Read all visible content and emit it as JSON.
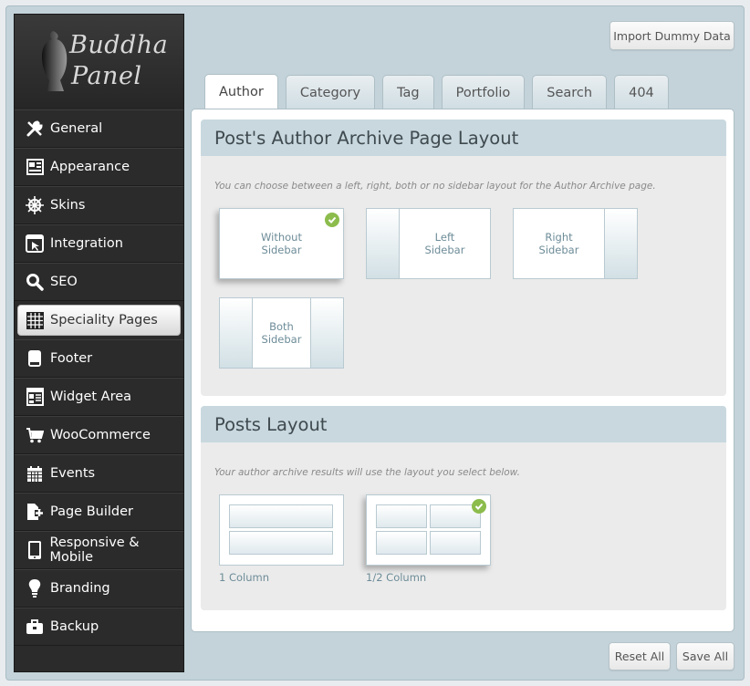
{
  "logo": {
    "line1": "Buddha",
    "line2": "Panel"
  },
  "sidebar": {
    "items": [
      {
        "label": "General",
        "icon": "wrench-screwdriver-icon"
      },
      {
        "label": "Appearance",
        "icon": "layout-icon"
      },
      {
        "label": "Skins",
        "icon": "ship-wheel-icon"
      },
      {
        "label": "Integration",
        "icon": "window-cursor-icon"
      },
      {
        "label": "SEO",
        "icon": "search-icon"
      },
      {
        "label": "Speciality Pages",
        "icon": "grid-icon",
        "active": true
      },
      {
        "label": "Footer",
        "icon": "footer-icon"
      },
      {
        "label": "Widget Area",
        "icon": "widget-icon"
      },
      {
        "label": "WooCommerce",
        "icon": "cart-icon"
      },
      {
        "label": "Events",
        "icon": "calendar-icon"
      },
      {
        "label": "Page Builder",
        "icon": "page-builder-icon"
      },
      {
        "label": "Responsive & Mobile",
        "icon": "mobile-icon"
      },
      {
        "label": "Branding",
        "icon": "lightbulb-icon"
      },
      {
        "label": "Backup",
        "icon": "briefcase-icon"
      }
    ]
  },
  "header": {
    "import_label": "Import Dummy Data"
  },
  "tabs": [
    "Author",
    "Category",
    "Tag",
    "Portfolio",
    "Search",
    "404"
  ],
  "active_tab": "Author",
  "section1": {
    "title": "Post's Author Archive Page Layout",
    "description": "You can choose between a left, right, both or no sidebar layout for the Author Archive page.",
    "options": {
      "without": "Without\nSidebar",
      "left": "Left\nSidebar",
      "right": "Right\nSidebar",
      "both": "Both\nSidebar"
    },
    "selected": "without"
  },
  "section2": {
    "title": "Posts Layout",
    "description": "Your author archive results will use the layout you select below.",
    "one_col": "1 Column",
    "half_col": "1/2 Column",
    "selected": "half"
  },
  "footer": {
    "reset_label": "Reset All",
    "save_label": "Save All"
  },
  "colors": {
    "accent": "#c8d8de",
    "check": "#8cbc4c",
    "sidebar_bg": "#2b2b2b"
  }
}
